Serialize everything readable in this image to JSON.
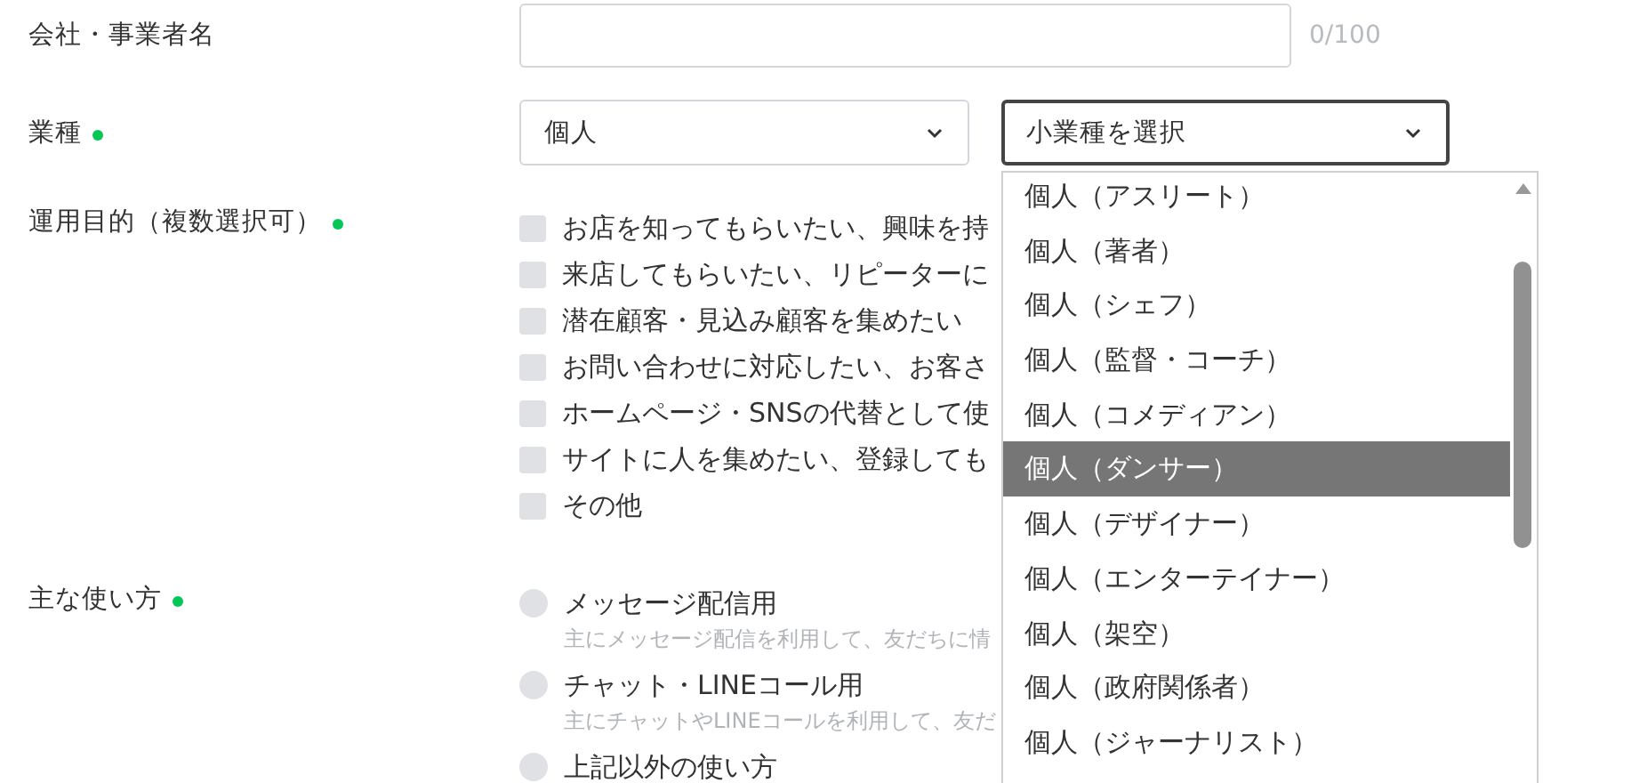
{
  "company": {
    "label": "会社・事業者名",
    "value_count": "0/100"
  },
  "industry": {
    "label": "業種",
    "required": true,
    "value": "個人",
    "sub_placeholder": "小業種を選択",
    "sub_open": true,
    "options": [
      {
        "label": "個人（アスリート）",
        "selected": false
      },
      {
        "label": "個人（著者）",
        "selected": false
      },
      {
        "label": "個人（シェフ）",
        "selected": false
      },
      {
        "label": "個人（監督・コーチ）",
        "selected": false
      },
      {
        "label": "個人（コメディアン）",
        "selected": false
      },
      {
        "label": "個人（ダンサー）",
        "selected": true
      },
      {
        "label": "個人（デザイナー）",
        "selected": false
      },
      {
        "label": "個人（エンターテイナー）",
        "selected": false
      },
      {
        "label": "個人（架空）",
        "selected": false
      },
      {
        "label": "個人（政府関係者）",
        "selected": false
      },
      {
        "label": "個人（ジャーナリスト）",
        "selected": false
      }
    ]
  },
  "purpose": {
    "label": "運用目的（複数選択可）",
    "required": true,
    "options": [
      {
        "label": "お店を知ってもらいたい、興味を持",
        "checked": false
      },
      {
        "label": "来店してもらいたい、リピーターに",
        "checked": false
      },
      {
        "label": "潜在顧客・見込み顧客を集めたい",
        "checked": false
      },
      {
        "label": "お問い合わせに対応したい、お客さ",
        "checked": false
      },
      {
        "label": "ホームページ・SNSの代替として使",
        "checked": false
      },
      {
        "label": "サイトに人を集めたい、登録しても",
        "checked": false
      },
      {
        "label": "その他",
        "checked": false
      }
    ]
  },
  "usage": {
    "label": "主な使い方",
    "required": true,
    "options": [
      {
        "label": "メッセージ配信用",
        "description": "主にメッセージ配信を利用して、友だちに情",
        "selected": false
      },
      {
        "label": "チャット・LINEコール用",
        "description": "主にチャットやLINEコールを利用して、友だ",
        "selected": false
      },
      {
        "label": "上記以外の使い方",
        "selected": false
      }
    ]
  }
}
